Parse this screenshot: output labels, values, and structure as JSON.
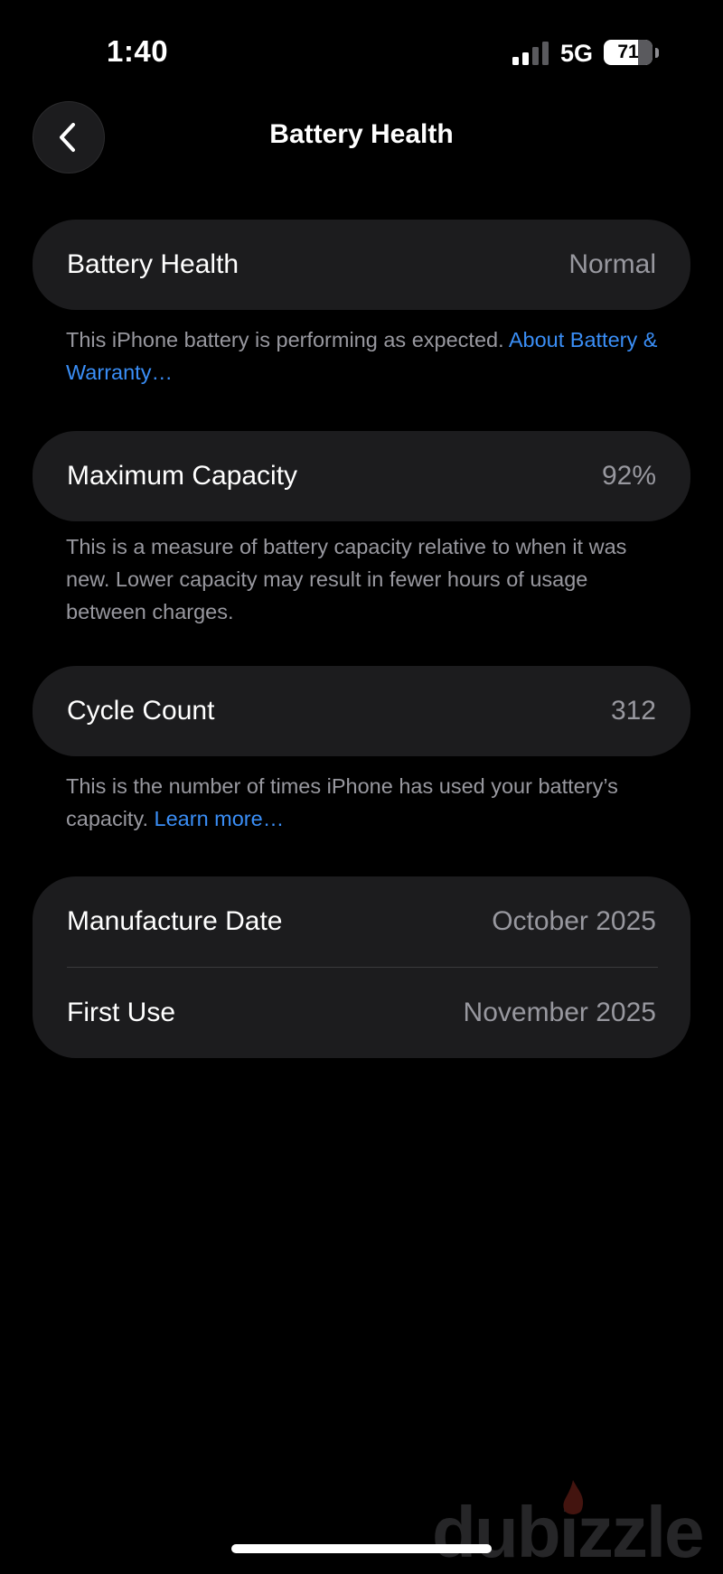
{
  "status_bar": {
    "time": "1:40",
    "network": "5G",
    "battery_level": "71",
    "battery_fraction": 0.71,
    "signal_bars_filled": 2,
    "signal_bars_total": 4
  },
  "nav": {
    "back_icon": "chevron-left-icon",
    "title": "Battery Health"
  },
  "sections": {
    "health": {
      "label": "Battery Health",
      "value": "Normal",
      "footnote": "This iPhone battery is performing as expected. ",
      "link": "About Battery & Warranty…"
    },
    "capacity": {
      "label": "Maximum Capacity",
      "value": "92%",
      "footnote": "This is a measure of battery capacity relative to when it was new. Lower capacity may result in fewer hours of usage between charges."
    },
    "cycles": {
      "label": "Cycle Count",
      "value": "312",
      "footnote": "This is the number of times iPhone has used your battery’s capacity. ",
      "link": "Learn more…"
    },
    "dates": {
      "manufacture_label": "Manufacture Date",
      "manufacture_value": "October 2025",
      "first_use_label": "First Use",
      "first_use_value": "November 2025"
    }
  },
  "watermark": {
    "text": "dubizzle"
  },
  "colors": {
    "background": "#000000",
    "card": "#1c1c1e",
    "secondary_text": "#98989f",
    "link": "#3a8ef6",
    "watermark_flame": "#c0392b"
  }
}
